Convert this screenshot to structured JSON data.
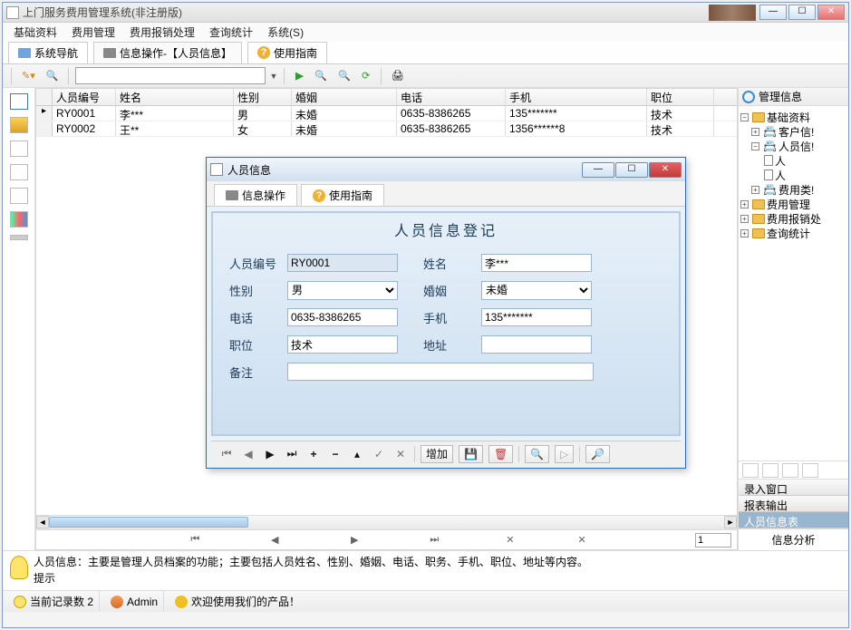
{
  "titlebar": {
    "title": "上门服务费用管理系统(非注册版)"
  },
  "menu": [
    "基础资料",
    "费用管理",
    "费用报销处理",
    "查询统计",
    "系统(S)"
  ],
  "tabs": {
    "nav": "系统导航",
    "info": "信息操作-【人员信息】",
    "guide": "使用指南"
  },
  "grid": {
    "columns": [
      "人员编号",
      "姓名",
      "性别",
      "婚姻",
      "电话",
      "手机",
      "职位"
    ],
    "rows": [
      {
        "id": "RY0001",
        "name": "李***",
        "sex": "男",
        "mar": "未婚",
        "tel": "0635-8386265",
        "mob": "135*******",
        "pos": "技术"
      },
      {
        "id": "RY0002",
        "name": "王**",
        "sex": "女",
        "mar": "未婚",
        "tel": "0635-8386265",
        "mob": "1356******8",
        "pos": "技术"
      }
    ],
    "page": "1"
  },
  "tree": {
    "title": "管理信息",
    "items": {
      "base": "基础资料",
      "cust": "客户信!",
      "person": "人员信!",
      "sub1": "人",
      "sub2": "人",
      "feetype": "费用类!",
      "feemgr": "费用管理",
      "feerpt": "费用报销处",
      "query": "查询统计"
    }
  },
  "right_buttons": {
    "input": "录入窗口",
    "report": "报表输出",
    "table": "人员信息表"
  },
  "right_footer": "信息分析",
  "hint": {
    "label": "提示",
    "text": "人员信息：主要是管理人员档案的功能；主要包括人员姓名、性别、婚姻、电话、职务、手机、职位、地址等内容。"
  },
  "status": {
    "records": "当前记录数 2",
    "user": "Admin",
    "welcome": "欢迎使用我们的产品！"
  },
  "dialog": {
    "title": "人员信息",
    "tabs": {
      "op": "信息操作",
      "guide": "使用指南"
    },
    "heading": "人员信息登记",
    "labels": {
      "id": "人员编号",
      "name": "姓名",
      "sex": "性别",
      "mar": "婚姻",
      "tel": "电话",
      "mob": "手机",
      "pos": "职位",
      "addr": "地址",
      "note": "备注"
    },
    "values": {
      "id": "RY0001",
      "name": "李***",
      "sex": "男",
      "mar": "未婚",
      "tel": "0635-8386265",
      "mob": "135*******",
      "pos": "技术",
      "addr": "",
      "note": ""
    },
    "add_btn": "增加"
  }
}
